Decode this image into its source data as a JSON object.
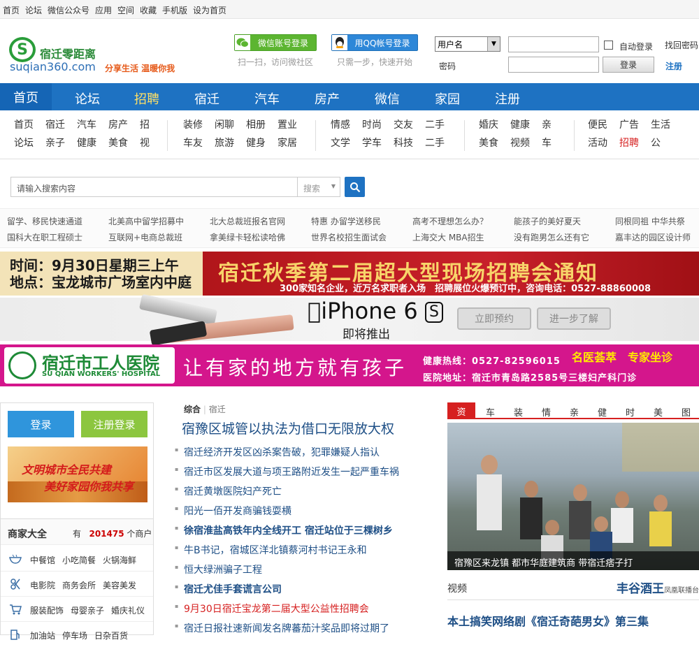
{
  "topbar": [
    "首页",
    "论坛",
    "微信公众号",
    "应用",
    "空间",
    "收藏",
    "手机版",
    "设为首页"
  ],
  "logo": {
    "cn": "宿迁零距离",
    "en": "suqian360.com",
    "tagline": "分享生活 温暖你我",
    "mark": "S"
  },
  "social": {
    "wechat_label": "微信账号登录",
    "wechat_hint": "扫一扫，访问微社区",
    "qq_label": "用QQ帐号登录",
    "qq_hint": "只需一步，快速开始"
  },
  "login": {
    "select_value": "用户名",
    "password_label": "密码",
    "auto_login": "自动登录",
    "forgot": "找回密码",
    "register": "注册",
    "login_button": "登录"
  },
  "nav": [
    "首页",
    "论坛",
    "招聘",
    "宿迁",
    "汽车",
    "房产",
    "微信",
    "家园",
    "注册"
  ],
  "subnav": [
    {
      "r1": [
        "首页",
        "宿迁",
        "汽车",
        "房产",
        "招"
      ],
      "r2": [
        "论坛",
        "亲子",
        "健康",
        "美食",
        "视"
      ]
    },
    {
      "r1": [
        "装修",
        "闲聊",
        "相册",
        "置业"
      ],
      "r2": [
        "车友",
        "旅游",
        "健身",
        "家居"
      ]
    },
    {
      "r1": [
        "情感",
        "时尚",
        "交友",
        "二手"
      ],
      "r2": [
        "文学",
        "学车",
        "科技",
        "二手"
      ]
    },
    {
      "r1": [
        "婚庆",
        "健康",
        "亲"
      ],
      "r2": [
        "美食",
        "视频",
        "车"
      ]
    },
    {
      "r1": [
        "便民",
        "广告",
        "生活"
      ],
      "r2": [
        "活动",
        "招聘",
        "公"
      ]
    }
  ],
  "search": {
    "placeholder": "请输入搜索内容",
    "type": "搜索"
  },
  "adlinks": {
    "row1": [
      "留学、移民快速通道",
      "北美高中留学招募中",
      "北大总裁班报名官网",
      "特惠 办留学送移民",
      "高考不理想怎么办？",
      "能孩子的美好夏天",
      "同根同祖 中华共祭"
    ],
    "row2": [
      "国科大在职工程硕士",
      "互联网+电商总裁班",
      "拿美绿卡轻松读哈佛",
      "世界名校招生面试会",
      "上海交大 MBA招生",
      "没有跑男怎么还有它",
      "嘉丰达的园区设计师"
    ]
  },
  "banner1": {
    "time": "时间：9月30日星期三上午",
    "place": "地点：宝龙城市广场室内中庭",
    "title": "宿迁秋季第二届超大型现场招聘会通知",
    "sub": "300家知名企业，近万名求职者入场　招聘展位火爆预订中，咨询电话：0527-88860008"
  },
  "banner2": {
    "title": "iPhone 6",
    "badge": "S",
    "sub": "即将推出",
    "btn1": "立即预约",
    "btn2": "进一步了解"
  },
  "banner3": {
    "name": "宿迁市工人医院",
    "en": "SU QIAN WORKERS' HOSPITAL",
    "slogan": "让有家的地方就有孩子",
    "hotline": "健康热线：0527-82596015",
    "address": "医院地址：宿迁市青岛路2585号三楼妇产科门诊",
    "promo": "名医荟萃　专家坐诊"
  },
  "left": {
    "login": "登录",
    "register": "注册登录",
    "promo1": "文明城市全民共建",
    "promo2": "美好家园你我共享",
    "shop_title": "商家大全",
    "shop_pre": "有",
    "shop_count": "201475",
    "shop_post": "个商户",
    "rows": [
      {
        "icon": "bowl-icon",
        "items": [
          "中餐馆",
          "小吃简餐",
          "火锅海鲜"
        ]
      },
      {
        "icon": "film-icon",
        "items": [
          "电影院",
          "商务会所",
          "美容美发"
        ]
      },
      {
        "icon": "cart-icon",
        "items": [
          "服装配饰",
          "母婴亲子",
          "婚庆礼仪"
        ]
      },
      {
        "icon": "gas-icon",
        "items": [
          "加油站",
          "停车场",
          "日杂百货"
        ]
      }
    ]
  },
  "mid": {
    "tab1": "综合",
    "tab2": "宿迁",
    "headline": "宿豫区城管以执法为借口无限放大权",
    "news": [
      {
        "t": "宿迁经济开发区凶杀案告破，犯罪嫌疑人指认",
        "s": ""
      },
      {
        "t": "宿迁市区发展大道与项王路附近发生一起严重车祸",
        "s": ""
      },
      {
        "t": "宿迁黄墩医院妇产死亡",
        "s": ""
      },
      {
        "t": "阳光一佰开发商骗钱耍横",
        "s": ""
      },
      {
        "t": "徐宿淮盐高铁年内全线开工 宿迁站位于三棵树乡",
        "s": "bold"
      },
      {
        "t": "牛B书记，宿城区洋北镇蔡河村书记王永和",
        "s": ""
      },
      {
        "t": "恒大绿洲骗子工程",
        "s": ""
      },
      {
        "t": "宿迁尤佳手套谎言公司",
        "s": "bold"
      },
      {
        "t": "9月30日宿迁宝龙第二届大型公益性招聘会",
        "s": "red"
      },
      {
        "t": "宿迁日报社速新闻发名牌蕃茄汁奖品即将过期了",
        "s": ""
      }
    ]
  },
  "right": {
    "tabs": [
      "资",
      "车",
      "装",
      "情",
      "亲",
      "健",
      "时",
      "美",
      "图"
    ],
    "caption": "宿豫区来龙镇 都市华庭建筑商 带宿迁痞子打",
    "video": "视频",
    "wine": "丰谷酒王",
    "wine_sub": "凤凰联播台",
    "news": "本土搞笑网络剧《宿迁奇葩男女》第三集"
  }
}
